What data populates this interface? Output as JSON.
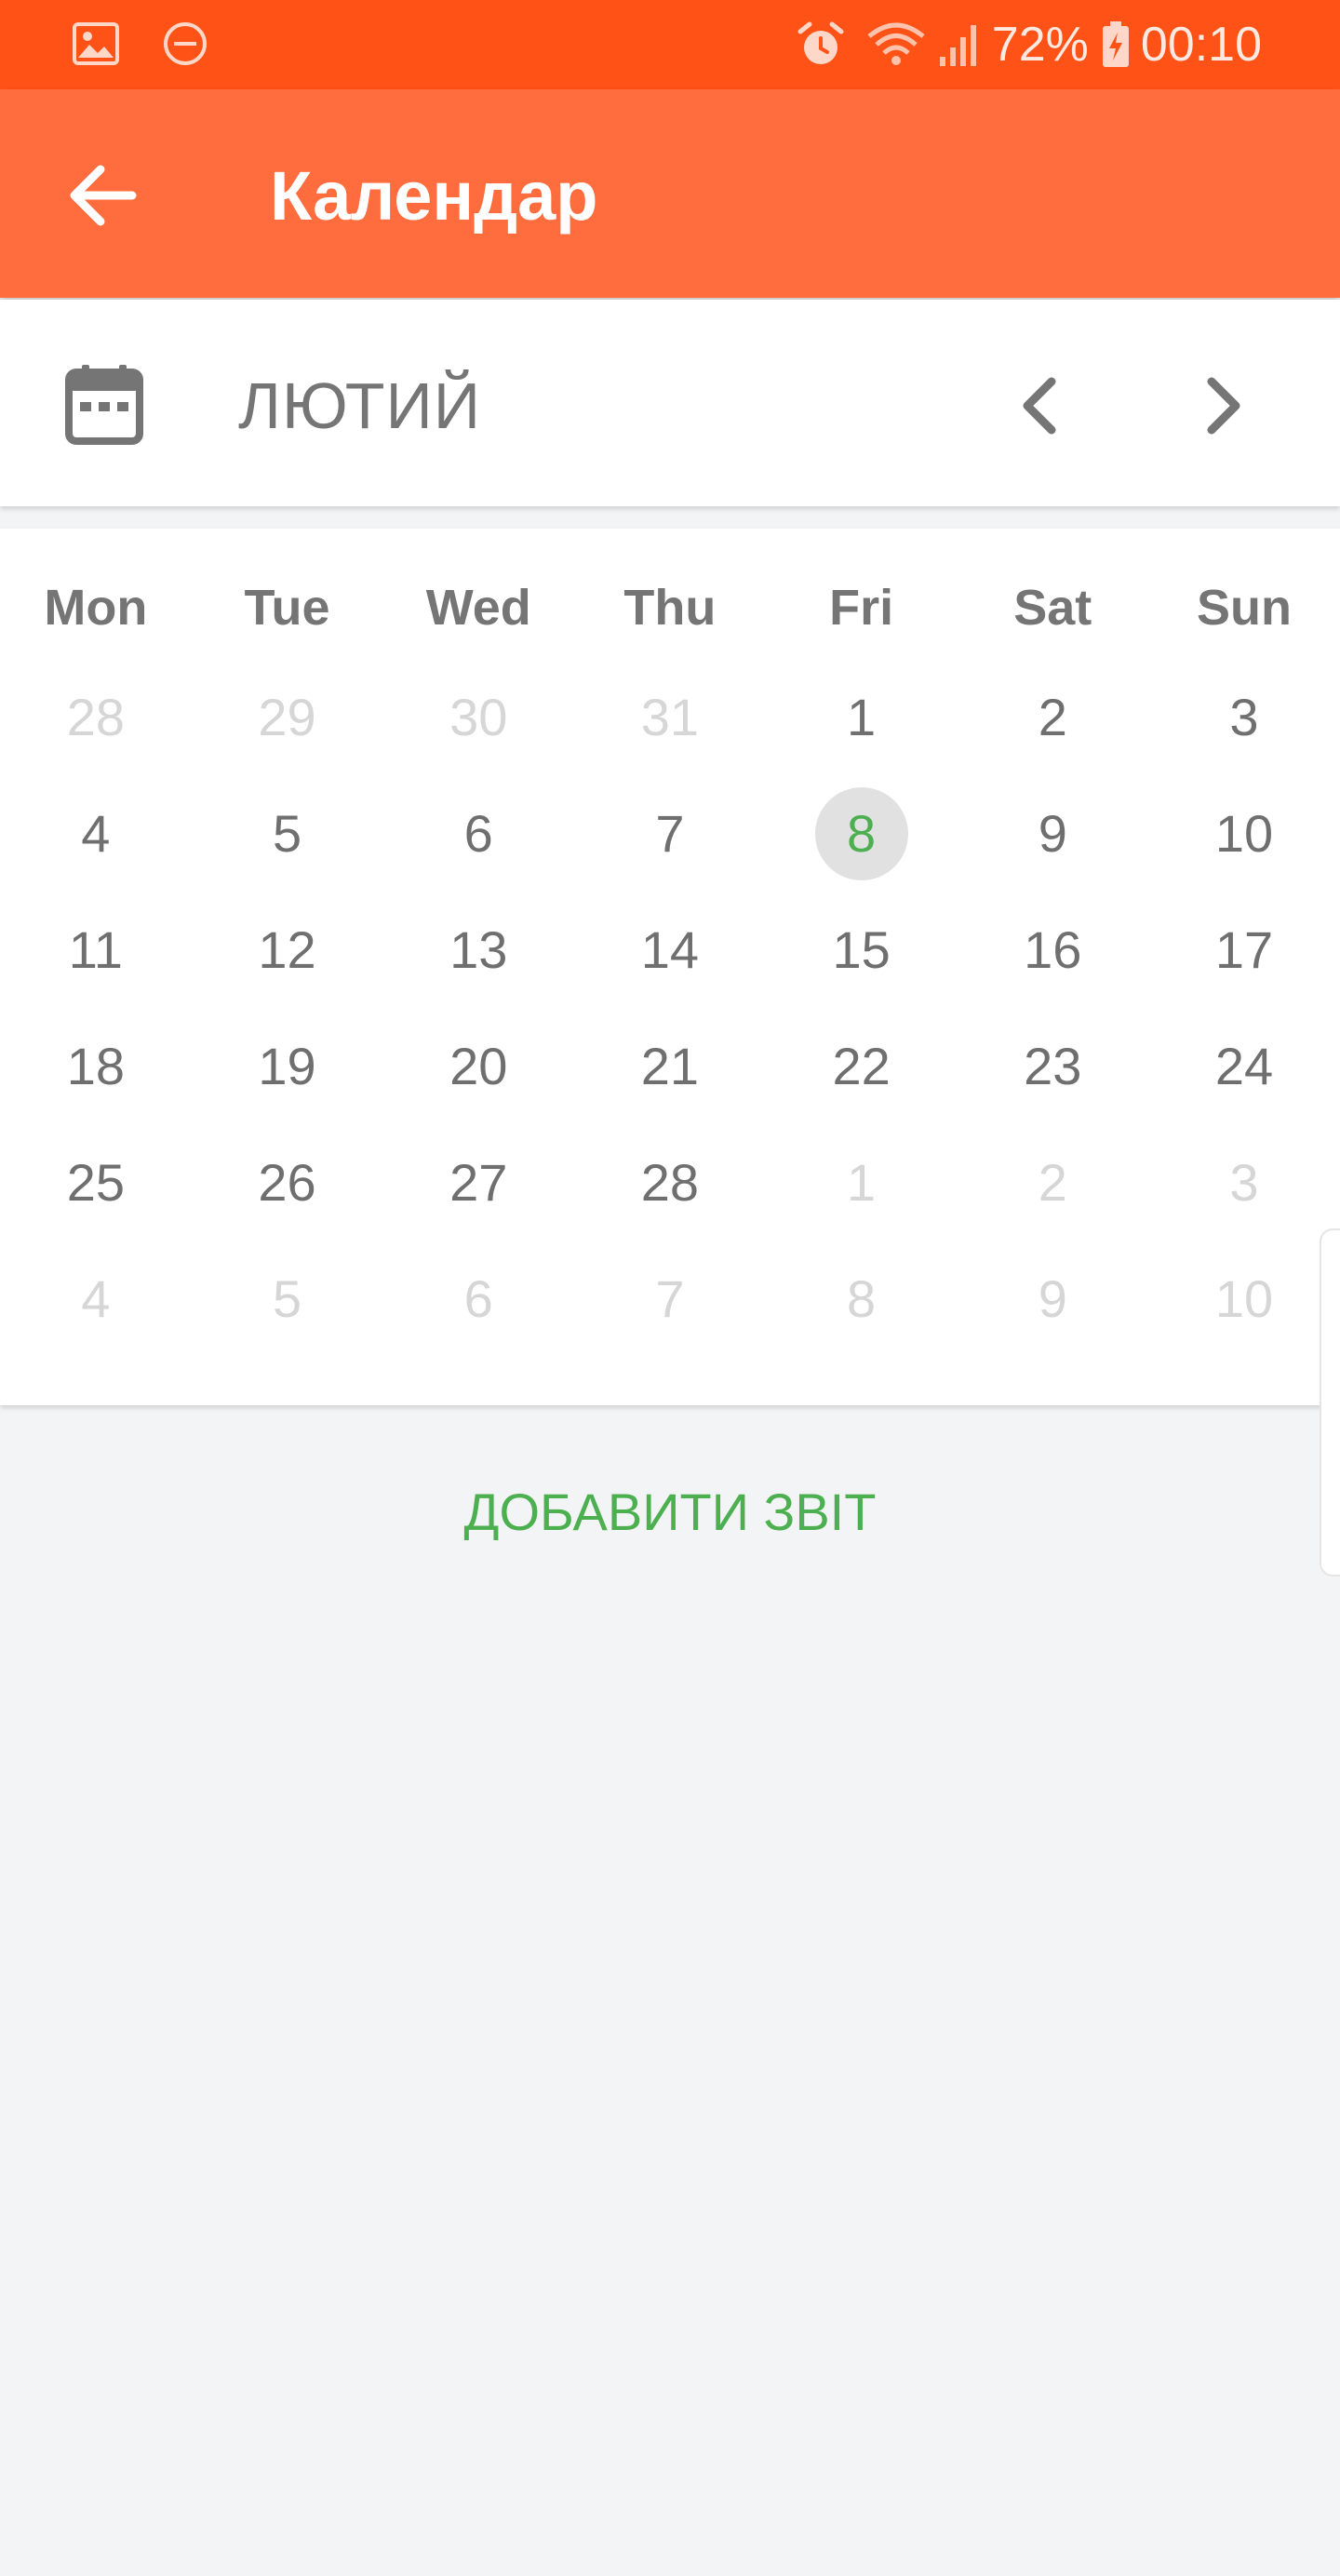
{
  "status_bar": {
    "battery": "72%",
    "time": "00:10",
    "icons": [
      "gallery-icon",
      "do-not-disturb-icon",
      "alarm-icon",
      "wifi-icon",
      "signal-icon",
      "battery-charging-icon"
    ],
    "color": "#ff5217"
  },
  "app_bar": {
    "title": "Календар",
    "back_icon": "arrow-back-icon",
    "color": "#ff6d3f"
  },
  "month_header": {
    "calendar_icon": "calendar-icon",
    "month": "ЛЮТИЙ",
    "prev_icon": "chevron-left-icon",
    "next_icon": "chevron-right-icon"
  },
  "calendar": {
    "weekdays": [
      "Mon",
      "Tue",
      "Wed",
      "Thu",
      "Fri",
      "Sat",
      "Sun"
    ],
    "weeks": [
      [
        {
          "d": "28",
          "m": true
        },
        {
          "d": "29",
          "m": true
        },
        {
          "d": "30",
          "m": true
        },
        {
          "d": "31",
          "m": true
        },
        {
          "d": "1",
          "m": false
        },
        {
          "d": "2",
          "m": false
        },
        {
          "d": "3",
          "m": false
        }
      ],
      [
        {
          "d": "4",
          "m": false
        },
        {
          "d": "5",
          "m": false
        },
        {
          "d": "6",
          "m": false
        },
        {
          "d": "7",
          "m": false
        },
        {
          "d": "8",
          "m": false,
          "today": true
        },
        {
          "d": "9",
          "m": false
        },
        {
          "d": "10",
          "m": false
        }
      ],
      [
        {
          "d": "11",
          "m": false
        },
        {
          "d": "12",
          "m": false
        },
        {
          "d": "13",
          "m": false
        },
        {
          "d": "14",
          "m": false
        },
        {
          "d": "15",
          "m": false
        },
        {
          "d": "16",
          "m": false
        },
        {
          "d": "17",
          "m": false
        }
      ],
      [
        {
          "d": "18",
          "m": false
        },
        {
          "d": "19",
          "m": false
        },
        {
          "d": "20",
          "m": false
        },
        {
          "d": "21",
          "m": false
        },
        {
          "d": "22",
          "m": false
        },
        {
          "d": "23",
          "m": false
        },
        {
          "d": "24",
          "m": false
        }
      ],
      [
        {
          "d": "25",
          "m": false
        },
        {
          "d": "26",
          "m": false
        },
        {
          "d": "27",
          "m": false
        },
        {
          "d": "28",
          "m": false
        },
        {
          "d": "1",
          "m": true
        },
        {
          "d": "2",
          "m": true
        },
        {
          "d": "3",
          "m": true
        }
      ],
      [
        {
          "d": "4",
          "m": true
        },
        {
          "d": "5",
          "m": true
        },
        {
          "d": "6",
          "m": true
        },
        {
          "d": "7",
          "m": true
        },
        {
          "d": "8",
          "m": true
        },
        {
          "d": "9",
          "m": true
        },
        {
          "d": "10",
          "m": true
        }
      ]
    ],
    "today_color": "#4caf50"
  },
  "actions": {
    "add_report": "ДОБАВИТИ ЗВІТ",
    "accent_color": "#4caf50"
  }
}
